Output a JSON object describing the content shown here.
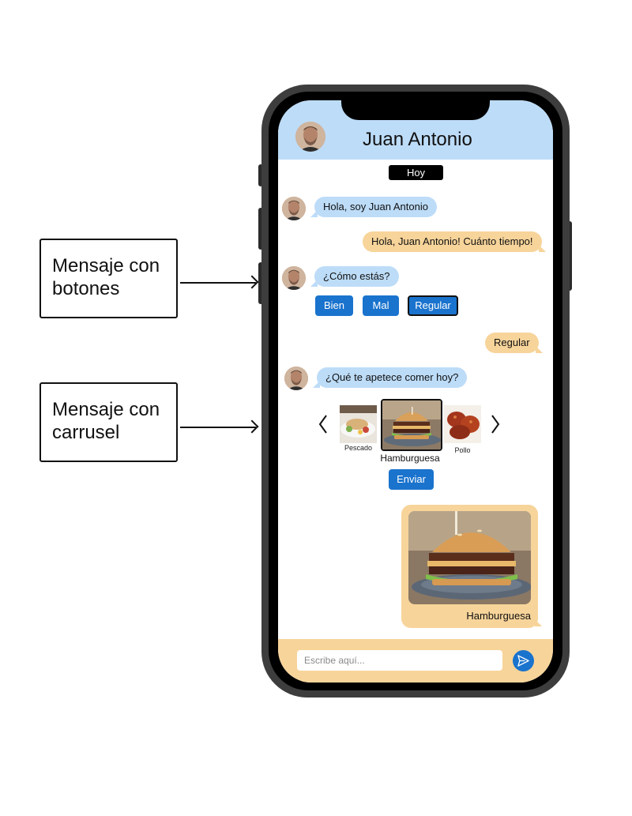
{
  "annotations": [
    {
      "label": "Mensaje con botones"
    },
    {
      "label": "Mensaje con carrusel"
    }
  ],
  "chat": {
    "contact_name": "Juan Antonio",
    "date_separator": "Hoy",
    "messages": [
      {
        "from": "contact",
        "text": "Hola, soy Juan Antonio"
      },
      {
        "from": "user",
        "text": "Hola, Juan Antonio! Cuánto tiempo!"
      },
      {
        "from": "contact",
        "text": "¿Cómo estás?"
      },
      {
        "from": "user",
        "text": "Regular"
      },
      {
        "from": "contact",
        "text": "¿Qué te apetece comer hoy?"
      }
    ],
    "quick_replies": [
      {
        "label": "Bien",
        "selected": false
      },
      {
        "label": "Mal",
        "selected": false
      },
      {
        "label": "Regular",
        "selected": true
      }
    ],
    "carousel": {
      "items": [
        {
          "label": "Pescado",
          "icon": "fish-dish-image"
        },
        {
          "label": "Hamburguesa",
          "icon": "burger-image",
          "selected": true
        },
        {
          "label": "Pollo",
          "icon": "chicken-image"
        }
      ],
      "submit_label": "Enviar"
    },
    "sent_card": {
      "caption": "Hamburguesa",
      "icon": "burger-image"
    },
    "composer": {
      "placeholder": "Escribe aquí..."
    }
  },
  "colors": {
    "header": "#bddcf8",
    "incoming_bubble": "#bddcf8",
    "outgoing_bubble": "#f7d49a",
    "button": "#1a73cd"
  }
}
